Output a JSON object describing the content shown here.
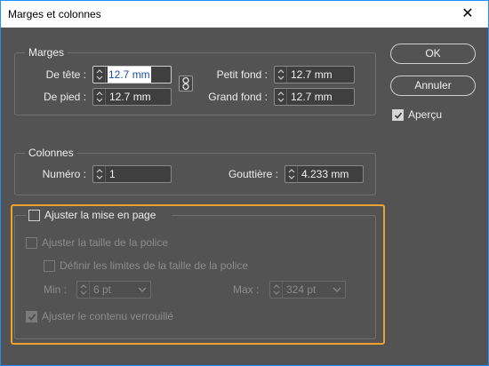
{
  "window": {
    "title": "Marges et colonnes",
    "close_glyph": "✕"
  },
  "margins": {
    "title": "Marges",
    "top_label": "De tête :",
    "top_value": "12.7 mm",
    "bottom_label": "De pied :",
    "bottom_value": "12.7 mm",
    "inside_label": "Petit fond :",
    "inside_value": "12.7 mm",
    "outside_label": "Grand fond :",
    "outside_value": "12.7 mm",
    "link_icon": "chain-link-icon"
  },
  "columns": {
    "title": "Colonnes",
    "number_label": "Numéro :",
    "number_value": "1",
    "gutter_label": "Gouttière :",
    "gutter_value": "4.233 mm"
  },
  "buttons": {
    "ok": "OK",
    "cancel": "Annuler",
    "preview_label": "Aperçu",
    "preview_checked": true
  },
  "adjust": {
    "title": "Ajuster la mise en page",
    "checked": false,
    "font_size_label": "Ajuster la taille de la police",
    "font_limits_label": "Définir les limites de la taille de la police",
    "min_label": "Min :",
    "min_value": "6 pt",
    "max_label": "Max :",
    "max_value": "324 pt",
    "locked_label": "Ajuster le contenu verrouillé",
    "locked_checked": true
  },
  "colors": {
    "dialog_bg": "#535353",
    "highlight": "#f0a030",
    "focus_border": "#1e90ff"
  }
}
